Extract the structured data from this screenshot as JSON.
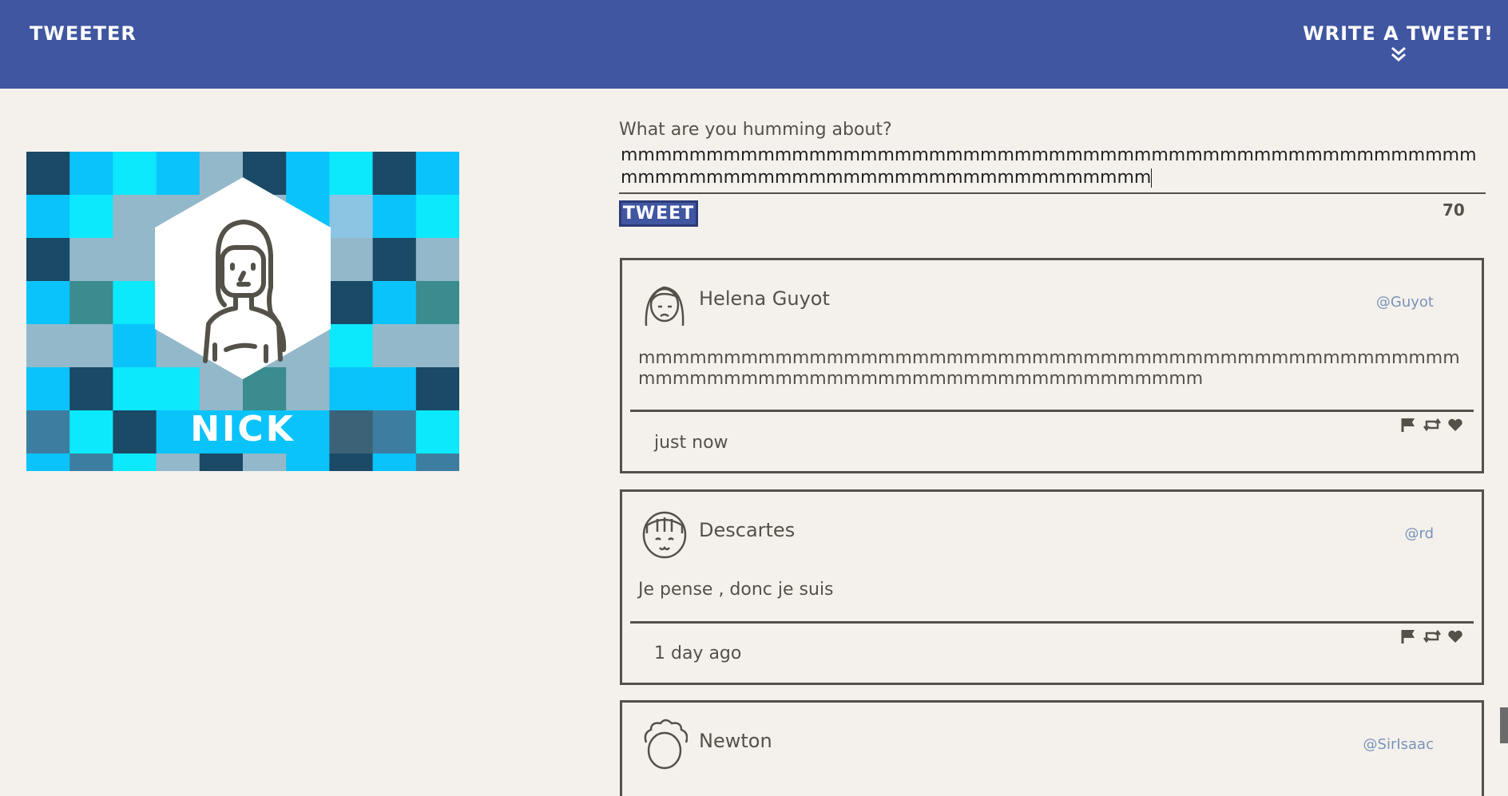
{
  "header": {
    "brand": "TWEETER",
    "write_label": "WRITE A TWEET!",
    "background": "#4056a1"
  },
  "profile": {
    "name": "NICK",
    "avatar_icon": "woman-avatar-icon"
  },
  "composer": {
    "prompt": "What are you humming about?",
    "text": "mmmmmmmmmmmmmmmmmmmmmmmmmmmmmmmmmmmmmmmmmmmmmmmmmmmmmmmmmmmmmmmmmmmmmmmmmmmmmmmmm",
    "button_label": "TWEET",
    "counter": "70"
  },
  "tweets": [
    {
      "name": "Helena Guyot",
      "handle": "@Guyot",
      "text": "mmmmmmmmmmmmmmmmmmmmmmmmmmmmmmmmmmmmmmmmmmmmmmmmmmmmmmmmmmmmmmmmmmmmmmmmmmmmmmmmm",
      "time": "just now",
      "avatar_icon": "sad-woman-avatar-icon"
    },
    {
      "name": "Descartes",
      "handle": "@rd",
      "text": "Je pense , donc je suis",
      "time": "1 day ago",
      "avatar_icon": "smiling-girl-avatar-icon"
    },
    {
      "name": "Newton",
      "handle": "@SirIsaac",
      "text": "",
      "time": "",
      "avatar_icon": "curly-hair-avatar-icon"
    }
  ]
}
